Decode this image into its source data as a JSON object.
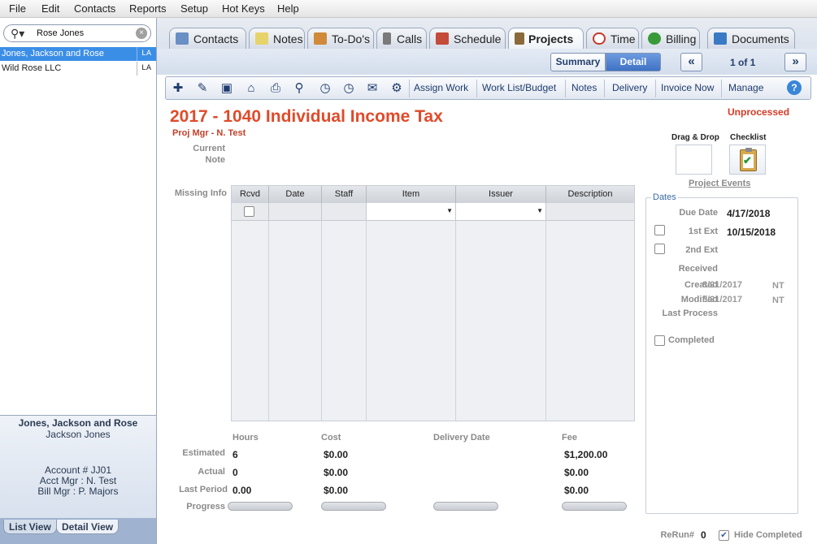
{
  "menu": [
    "File",
    "Edit",
    "Contacts",
    "Reports",
    "Setup",
    "Hot Keys",
    "Help"
  ],
  "search": {
    "value": "Rose Jones",
    "clear_label": "×"
  },
  "clients": [
    {
      "name": "Jones, Jackson and Rose",
      "state": "LA",
      "selected": true
    },
    {
      "name": "Wild Rose LLC",
      "state": "LA",
      "selected": false
    }
  ],
  "client_info": {
    "name": "Jones, Jackson and Rose",
    "contact": "Jackson Jones",
    "account": "Account # JJ01",
    "acct_mgr": "Acct Mgr : N. Test",
    "bill_mgr": "Bill Mgr : P. Majors"
  },
  "view_tabs": {
    "list": "List View",
    "detail": "Detail View",
    "active": "detail"
  },
  "tabs": [
    {
      "label": "Contacts",
      "color": "#6a8fc4"
    },
    {
      "label": "Notes",
      "color": "#e6d36a"
    },
    {
      "label": "To-Do's",
      "color": "#d08a3a"
    },
    {
      "label": "Calls",
      "color": "#7a7a7a"
    },
    {
      "label": "Schedule",
      "color": "#c44a3a"
    },
    {
      "label": "Projects",
      "color": "#8a6a3a",
      "active": true
    },
    {
      "label": "Time",
      "color": "#c43a2a"
    },
    {
      "label": "Billing",
      "color": "#3a9a3a"
    },
    {
      "label": "Documents",
      "color": "#3a7ac4"
    }
  ],
  "nav": {
    "summary": "Summary",
    "detail": "Detail",
    "prev": "«",
    "next": "»",
    "page": "1 of 1"
  },
  "toolbar": {
    "icons": [
      "add-icon",
      "edit-icon",
      "save-icon",
      "delete-icon",
      "print-icon",
      "search-icon",
      "schedule-clock-icon",
      "clock-icon",
      "email-icon",
      "settings-gear-icon"
    ],
    "glyphs": [
      "✚",
      "✎",
      "▣",
      "⌂",
      "⎙",
      "⚲",
      "◷",
      "◷",
      "✉",
      "⚙"
    ],
    "links": [
      "Assign Work",
      "Work List/Budget",
      "Notes",
      "Delivery",
      "Invoice Now",
      "Manage"
    ],
    "help": "?"
  },
  "project": {
    "title": "2017 - 1040 Individual Income Tax",
    "status": "Unprocessed",
    "proj_mgr": "Proj Mgr - N. Test",
    "current_label": "Current",
    "note_label": "Note",
    "missing_info_label": "Missing Info"
  },
  "missing_table": {
    "columns": [
      "Rcvd",
      "Date",
      "Staff",
      "Item",
      "Issuer",
      "Description"
    ]
  },
  "side": {
    "drag_drop": "Drag & Drop",
    "checklist": "Checklist",
    "events": "Project Events"
  },
  "dates": {
    "legend": "Dates",
    "due_label": "Due Date",
    "due_value": "4/17/2018",
    "ext1_label": "1st Ext",
    "ext1_value": "10/15/2018",
    "ext2_label": "2nd Ext",
    "received_label": "Received",
    "created_label": "Created",
    "created_value": "8/21/2017",
    "created_by": "NT",
    "modified_label": "Modified",
    "modified_value": "8/21/2017",
    "modified_by": "NT",
    "last_process_label": "Last Process",
    "completed_label": "Completed"
  },
  "financials": {
    "headers": {
      "hours": "Hours",
      "cost": "Cost",
      "delivery": "Delivery Date",
      "fee": "Fee"
    },
    "rows": [
      {
        "label": "Estimated",
        "hours": "6",
        "cost": "$0.00",
        "fee": "$1,200.00"
      },
      {
        "label": "Actual",
        "hours": "0",
        "cost": "$0.00",
        "fee": "$0.00"
      },
      {
        "label": "Last Period",
        "hours": "0.00",
        "cost": "$0.00",
        "fee": "$0.00"
      }
    ],
    "progress_label": "Progress",
    "progress": {
      "hours": 0,
      "cost": 0,
      "delivery": 0,
      "fee": 0
    }
  },
  "footer": {
    "rerun_label": "ReRun#",
    "rerun_value": "0",
    "hide_completed": "Hide Completed",
    "hide_checked": true
  },
  "colors": {
    "accent": "#e04a2a",
    "selection": "#3b8ee6",
    "status": "#d83a26"
  }
}
